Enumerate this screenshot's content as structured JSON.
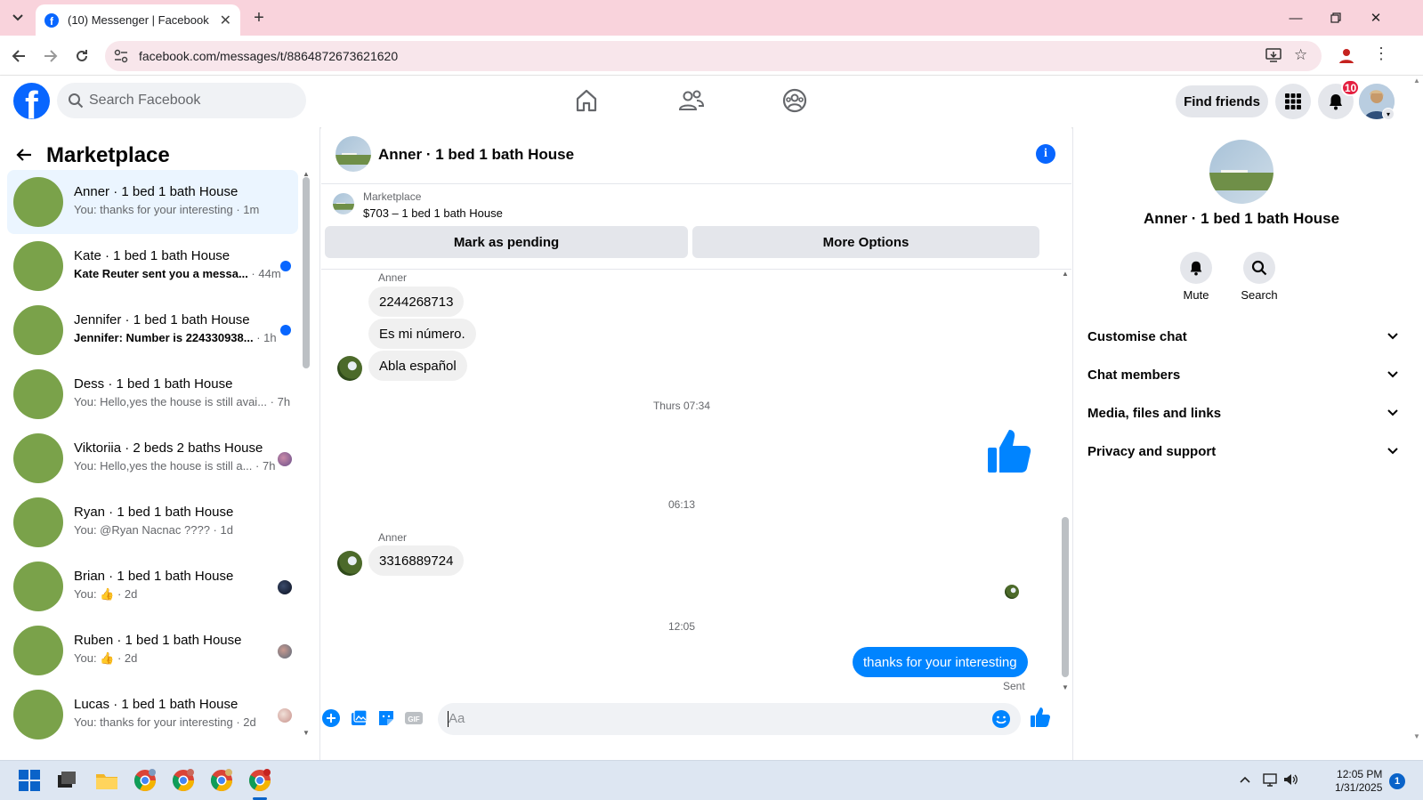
{
  "browser": {
    "tab_title": "(10) Messenger | Facebook",
    "url": "facebook.com/messages/t/8864872673621620"
  },
  "fb_header": {
    "search_placeholder": "Search Facebook",
    "find_friends": "Find friends",
    "notification_count": "10",
    "brand_color": "#0866ff"
  },
  "left_panel": {
    "title": "Marketplace",
    "conversations": [
      {
        "name": "Anner · 1 bed 1 bath House",
        "preview": "You: thanks for your interesting",
        "time": " · 1m",
        "unread": false,
        "active": true,
        "indicator": "none"
      },
      {
        "name": "Kate · 1 bed 1 bath House",
        "preview": "Kate Reuter sent you a messa...",
        "time": " · 44m",
        "unread": true,
        "active": false,
        "indicator": "dot"
      },
      {
        "name": "Jennifer · 1 bed 1 bath House",
        "preview": "Jennifer: Number is 224330938...",
        "time": " · 1h",
        "unread": true,
        "active": false,
        "indicator": "dot"
      },
      {
        "name": "Dess · 1 bed 1 bath House",
        "preview": "You: Hello,yes the house is still avai...",
        "time": " · 7h",
        "unread": false,
        "active": false,
        "indicator": "none"
      },
      {
        "name": "Viktoriia · 2 beds 2 baths House",
        "preview": "You: Hello,yes the house is still a...",
        "time": " · 7h",
        "unread": false,
        "active": false,
        "indicator": "seen"
      },
      {
        "name": "Ryan · 1 bed 1 bath House",
        "preview": "You: @Ryan Nacnac ????",
        "time": " · 1d",
        "unread": false,
        "active": false,
        "indicator": "none"
      },
      {
        "name": "Brian · 1 bed 1 bath House",
        "preview": "You: 👍",
        "time": " · 2d",
        "unread": false,
        "active": false,
        "indicator": "seen"
      },
      {
        "name": "Ruben · 1 bed 1 bath House",
        "preview": "You: 👍",
        "time": " · 2d",
        "unread": false,
        "active": false,
        "indicator": "seen"
      },
      {
        "name": "Lucas · 1 bed 1 bath House",
        "preview": "You: thanks for your interesting",
        "time": " · 2d",
        "unread": false,
        "active": false,
        "indicator": "seen"
      }
    ]
  },
  "chat": {
    "title": "Anner · 1 bed 1 bath House",
    "marketplace_label": "Marketplace",
    "listing": "$703 – 1 bed 1 bath House",
    "mark_pending": "Mark as pending",
    "more_options": "More Options",
    "sender_name": "Anner",
    "group1": [
      "2244268713",
      "Es mi número.",
      "Abla español"
    ],
    "time1": "Thurs 07:34",
    "time2": "06:13",
    "group2": [
      "3316889724"
    ],
    "time3": "12:05",
    "outgoing": "thanks for your interesting",
    "sent_label": "Sent",
    "composer_placeholder": "Aa"
  },
  "right_panel": {
    "title": "Anner · 1 bed 1 bath House",
    "mute": "Mute",
    "search": "Search",
    "sections": [
      "Customise chat",
      "Chat members",
      "Media, files and links",
      "Privacy and support"
    ]
  },
  "taskbar": {
    "time": "12:05 PM",
    "date": "1/31/2025",
    "notifications": "1"
  }
}
